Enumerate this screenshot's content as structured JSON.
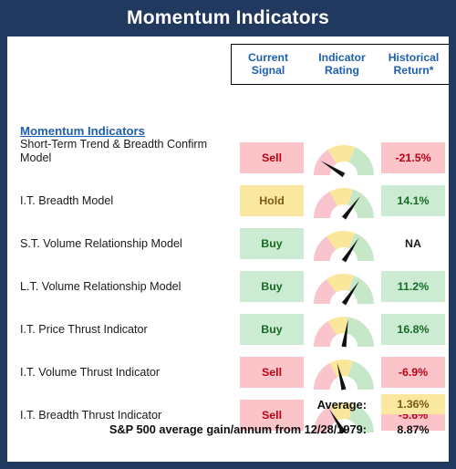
{
  "title": "Momentum Indicators",
  "colors": {
    "frame": "#21395F",
    "header_text": "#1F5FB0",
    "sell_bg": "#FAC4C9",
    "sell_text": "#C00014",
    "hold_bg": "#FAE7A0",
    "hold_text": "#7A5A10",
    "buy_bg": "#CCEBD3",
    "buy_text": "#176B22",
    "gauge_red": "#F9C4CB",
    "gauge_yellow": "#FAE79B",
    "gauge_green": "#C6E8C9",
    "needle": "#111111"
  },
  "columns": {
    "signal": {
      "line1": "Current",
      "line2": "Signal"
    },
    "rating": {
      "line1": "Indicator",
      "line2": "Rating"
    },
    "return": {
      "line1": "Historical",
      "line2": "Return*"
    }
  },
  "section_title": "Momentum Indicators",
  "rows": [
    {
      "label": "Short-Term Trend & Breadth Confirm Model",
      "signal": "Sell",
      "signal_state": "sell",
      "return": "-21.5%",
      "return_state": "neg",
      "needle_deg": -58,
      "red_end": 58,
      "yellow_end": 112
    },
    {
      "label": "I.T. Breadth Model",
      "signal": "Hold",
      "signal_state": "hold",
      "return": "14.1%",
      "return_state": "pos",
      "needle_deg": 37,
      "red_end": 62,
      "yellow_end": 108
    },
    {
      "label": "S.T. Volume Relationship Model",
      "signal": "Buy",
      "signal_state": "buy",
      "return": "NA",
      "return_state": "na",
      "needle_deg": 33,
      "red_end": 55,
      "yellow_end": 112
    },
    {
      "label": "L.T. Volume Relationship Model",
      "signal": "Buy",
      "signal_state": "buy",
      "return": "11.2%",
      "return_state": "pos",
      "needle_deg": 34,
      "red_end": 55,
      "yellow_end": 110
    },
    {
      "label": "I.T. Price Thrust Indicator",
      "signal": "Buy",
      "signal_state": "buy",
      "return": "16.8%",
      "return_state": "pos",
      "needle_deg": 9,
      "red_end": 58,
      "yellow_end": 98
    },
    {
      "label": "I.T. Volume Thrust Indicator",
      "signal": "Sell",
      "signal_state": "sell",
      "return": "-6.9%",
      "return_state": "neg",
      "needle_deg": -14,
      "red_end": 62,
      "yellow_end": 108
    },
    {
      "label": "I.T. Breadth Thrust Indicator",
      "signal": "Sell",
      "signal_state": "sell",
      "return": "-5.6%",
      "return_state": "neg",
      "needle_deg": -32,
      "red_end": 62,
      "yellow_end": 110
    }
  ],
  "footer": {
    "average_label": "Average:",
    "average_value": "1.36%",
    "benchmark_label": "S&P 500 average gain/annum from 12/28/1979:",
    "benchmark_value": "8.87%"
  }
}
